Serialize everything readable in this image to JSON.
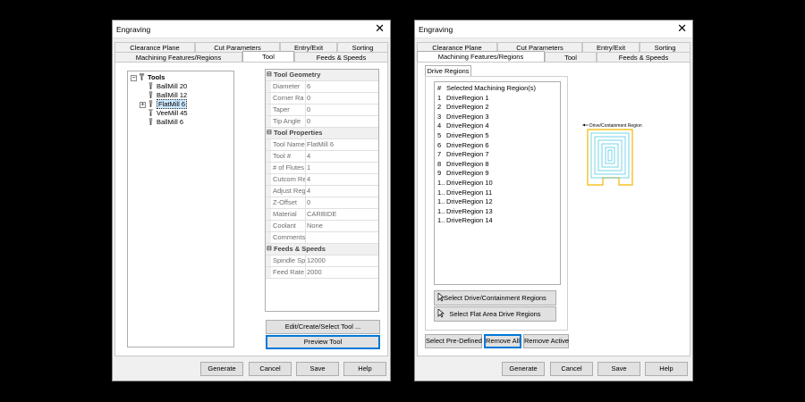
{
  "left": {
    "title": "Engraving",
    "tabs_row1": [
      "Clearance Plane",
      "Cut Parameters",
      "Entry/Exit",
      "Sorting"
    ],
    "tabs_row2": [
      "Machining Features/Regions",
      "Tool",
      "Feeds & Speeds"
    ],
    "active_tab": "Tool",
    "tree": {
      "root": "Tools",
      "items": [
        {
          "label": "BallMill 20",
          "selected": false
        },
        {
          "label": "BallMill 12",
          "selected": false
        },
        {
          "label": "FlatMill 6",
          "selected": true
        },
        {
          "label": "VeeMill 45",
          "selected": false
        },
        {
          "label": "BallMill 6",
          "selected": false
        }
      ]
    },
    "grid": [
      {
        "category": "Tool Geometry"
      },
      {
        "key": "Diameter",
        "value": "6"
      },
      {
        "key": "Corner Ra",
        "value": "0"
      },
      {
        "key": "Taper",
        "value": "0"
      },
      {
        "key": "Tip Angle",
        "value": "0"
      },
      {
        "category": "Tool Properties"
      },
      {
        "key": "Tool Name",
        "value": "FlatMill 6"
      },
      {
        "key": "Tool #",
        "value": "4"
      },
      {
        "key": "# of Flutes",
        "value": "1"
      },
      {
        "key": "Cutcom Re",
        "value": "4"
      },
      {
        "key": "Adjust Reg",
        "value": "4"
      },
      {
        "key": "Z-Offset",
        "value": "0"
      },
      {
        "key": "Material",
        "value": "CARBIDE"
      },
      {
        "key": "Coolant",
        "value": "None"
      },
      {
        "key": "Comments",
        "value": ""
      },
      {
        "category": "Feeds & Speeds"
      },
      {
        "key": "Spindle Sp",
        "value": "12000"
      },
      {
        "key": "Feed Rate",
        "value": "2000"
      }
    ],
    "edit_button": "Edit/Create/Select Tool ...",
    "preview_button": "Preview Tool",
    "footer": [
      "Generate",
      "Cancel",
      "Save",
      "Help"
    ]
  },
  "right": {
    "title": "Engraving",
    "tabs_row1": [
      "Clearance Plane",
      "Cut Parameters",
      "Entry/Exit",
      "Sorting"
    ],
    "tabs_row2": [
      "Machining Features/Regions",
      "Tool",
      "Feeds & Speeds"
    ],
    "active_tab": "Machining Features/Regions",
    "subtab": "Drive Regions",
    "list_header": {
      "num": "#",
      "label": "Selected Machining Region(s)"
    },
    "regions": [
      {
        "num": "1",
        "label": "DriveRegion 1"
      },
      {
        "num": "2",
        "label": "DriveRegion 2"
      },
      {
        "num": "3",
        "label": "DriveRegion 3"
      },
      {
        "num": "4",
        "label": "DriveRegion 4"
      },
      {
        "num": "5",
        "label": "DriveRegion 5"
      },
      {
        "num": "6",
        "label": "DriveRegion 6"
      },
      {
        "num": "7",
        "label": "DriveRegion 7"
      },
      {
        "num": "8",
        "label": "DriveRegion 8"
      },
      {
        "num": "9",
        "label": "DriveRegion 9"
      },
      {
        "num": "1..",
        "label": "DriveRegion 10"
      },
      {
        "num": "1..",
        "label": "DriveRegion 11"
      },
      {
        "num": "1..",
        "label": "DriveRegion 12"
      },
      {
        "num": "1..",
        "label": "DriveRegion 13"
      },
      {
        "num": "1..",
        "label": "DriveRegion 14"
      }
    ],
    "select_drive_button": "Select Drive/Containment Regions",
    "select_flat_button": "Select Flat Area Drive Regions",
    "predefined_button": "Select Pre-Defined",
    "remove_all_button": "Remove All",
    "remove_active_button": "Remove Active",
    "preview_caption": "Drive/Containment Region",
    "footer": [
      "Generate",
      "Cancel",
      "Save",
      "Help"
    ]
  },
  "colors": {
    "selection": "#cce8ff",
    "focus": "#0078d7",
    "containment": "#f5b800",
    "drive": "#39c2e0"
  }
}
